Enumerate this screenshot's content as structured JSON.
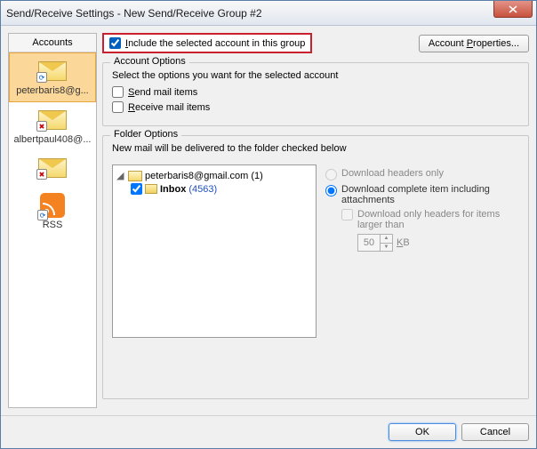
{
  "window": {
    "title": "Send/Receive Settings - New Send/Receive Group #2"
  },
  "sidebar": {
    "header": "Accounts",
    "items": [
      {
        "label": "peterbaris8@g...",
        "badge": "sync"
      },
      {
        "label": "albertpaul408@...",
        "badge": "err"
      },
      {
        "label": "",
        "badge": "err"
      },
      {
        "label": "RSS",
        "badge": "rss"
      }
    ]
  },
  "include": {
    "label_pre": "I",
    "label_rest": "nclude the selected account in this group",
    "checked": true
  },
  "acct_props_btn": {
    "pre": "Account ",
    "u": "P",
    "post": "roperties..."
  },
  "account_options": {
    "title": "Account Options",
    "desc": "Select the options you want for the selected account",
    "send": {
      "u": "S",
      "rest": "end mail items"
    },
    "recv": {
      "u": "R",
      "rest": "eceive mail items"
    }
  },
  "folder_options": {
    "title": "Folder Options",
    "desc": "New mail will be delivered to the folder checked below",
    "account_name": "peterbaris8@gmail.com",
    "account_count": "(1)",
    "inbox_label": "Inbox",
    "inbox_count": "(4563)"
  },
  "download": {
    "headers_only": "Download headers only",
    "complete": "Download complete item including attachments",
    "only_headers_larger": "Download only headers for items larger than",
    "size_value": "50",
    "size_unit_u": "K",
    "size_unit_rest": "B"
  },
  "footer": {
    "ok": "OK",
    "cancel": "Cancel"
  }
}
